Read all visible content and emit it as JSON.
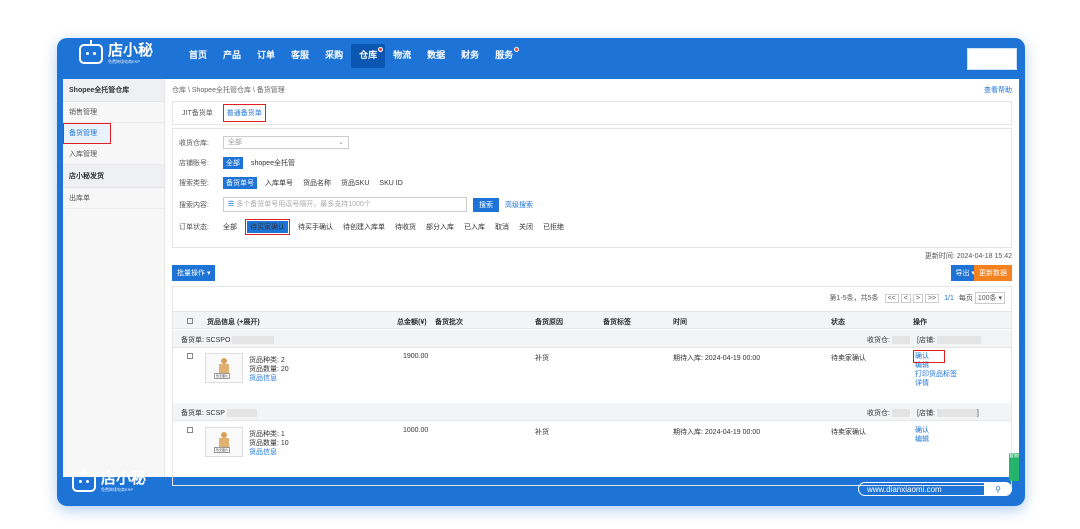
{
  "brand": {
    "name": "店小秘",
    "sub": "免费跨境电商ERP"
  },
  "nav": [
    {
      "label": "首页",
      "active": false,
      "dot": false
    },
    {
      "label": "产品",
      "active": false,
      "dot": false
    },
    {
      "label": "订单",
      "active": false,
      "dot": false
    },
    {
      "label": "客服",
      "active": false,
      "dot": false
    },
    {
      "label": "采购",
      "active": false,
      "dot": false
    },
    {
      "label": "仓库",
      "active": true,
      "dot": true
    },
    {
      "label": "物流",
      "active": false,
      "dot": false
    },
    {
      "label": "数据",
      "active": false,
      "dot": false
    },
    {
      "label": "财务",
      "active": false,
      "dot": false
    },
    {
      "label": "服务",
      "active": false,
      "dot": true
    }
  ],
  "sidebar": {
    "section1": "Shopee全托管仓库",
    "items1": [
      "销售管理",
      "备货管理",
      "入库管理"
    ],
    "section2": "店小秘发货",
    "items2": [
      "出库单"
    ]
  },
  "breadcrumb": "仓库 \\ Shopee全托管仓库 \\ 备货管理",
  "help": "查看帮助",
  "tabs": [
    "JIT备货单",
    "普通备货单"
  ],
  "filters": {
    "warehouse_label": "收货仓库:",
    "warehouse_value": "全部",
    "shop_label": "店铺账号:",
    "shop_all": "全部",
    "shop_name": "shopee全托管",
    "search_type_label": "搜索类型:",
    "search_types": [
      "备货单号",
      "入库单号",
      "货品名称",
      "货品SKU",
      "SKU ID"
    ],
    "search_content_label": "搜索内容:",
    "search_placeholder": "多个备货单号用逗号隔开，最多支持1000个",
    "search_btn": "搜索",
    "advanced": "高级搜索",
    "status_label": "订单状态:",
    "statuses": [
      "全部",
      "待买家确认",
      "待买手确认",
      "待创建入库单",
      "待收货",
      "部分入库",
      "已入库",
      "取消",
      "关闭",
      "已拒绝"
    ]
  },
  "updated": "更新时间: 2024-04-18 15:42",
  "batch_btn": "批量操作 ▾",
  "export_btn": "导出 ▾",
  "refresh_btn": "更新数据",
  "pager": {
    "summary": "第1-5条，共5条",
    "buttons": [
      "<<",
      "<",
      ">",
      ">>"
    ],
    "page": "1/1",
    "per_page_label": "每页",
    "per_page": "100条 ▾"
  },
  "columns": [
    "货品信息 (+展开)",
    "总金额(¥)",
    "备货批次",
    "备货原因",
    "备货标签",
    "时间",
    "状态",
    "操作"
  ],
  "orders": [
    {
      "order_label": "备货单: SCSPO",
      "recv_label": "收货仓:",
      "shop_label": "[店铺:",
      "kinds": "货品种类: 2",
      "qty": "货品数量: 20",
      "info_link": "货品信息",
      "amount": "1900.00",
      "reason": "补货",
      "time": "期待入库: 2024-04-19 00:00",
      "status": "待卖家确认",
      "ops": [
        "确认",
        "编辑",
        "打印货品标签",
        "详情"
      ]
    },
    {
      "order_label": "备货单: SCSP",
      "recv_label": "收货仓:",
      "shop_label": "[店铺:",
      "shop_end": "]",
      "kinds": "货品种类: 1",
      "qty": "货品数量: 10",
      "info_link": "货品信息",
      "amount": "1000.00",
      "reason": "补货",
      "time": "期待入库: 2024-04-19 00:00",
      "status": "待卖家确认",
      "ops": [
        "确认",
        "编辑"
      ]
    }
  ],
  "thumb_label": "暂无图片",
  "side_tab": "客服",
  "url": "www.dianxiaomi.com",
  "url_icon": "search-icon"
}
